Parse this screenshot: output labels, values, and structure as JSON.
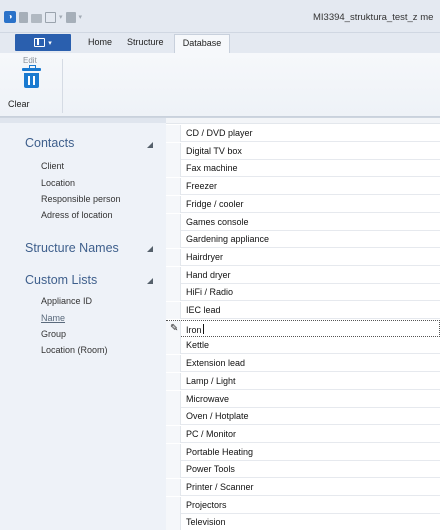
{
  "window": {
    "title": "MI3394_struktura_test_z me"
  },
  "ribbon": {
    "tabs": [
      "Home",
      "Structure",
      "Database"
    ],
    "active_tab": "Database",
    "edit_group_label": "Edit",
    "clear_label": "Clear"
  },
  "sidebar": {
    "contacts": {
      "title": "Contacts",
      "items": [
        "Client",
        "Location",
        "Responsible person",
        "Adress of location"
      ]
    },
    "structure_names": {
      "title": "Structure Names"
    },
    "custom_lists": {
      "title": "Custom Lists",
      "items": [
        "Appliance ID",
        "Name",
        "Group",
        "Location (Room)"
      ],
      "selected": "Name"
    }
  },
  "grid": {
    "rows": [
      "CD / DVD player",
      "Digital TV box",
      "Fax machine",
      "Freezer",
      "Fridge / cooler",
      "Games console",
      "Gardening appliance",
      "Hairdryer",
      "Hand dryer",
      "HiFi / Radio",
      "IEC lead",
      "Iron",
      "Kettle",
      "Extension lead",
      "Lamp / Light",
      "Microwave",
      "Oven / Hotplate",
      "PC / Monitor",
      "Portable Heating",
      "Power Tools",
      "Printer / Scanner",
      "Projectors",
      "Television"
    ],
    "editing_row": "Iron"
  },
  "icons": {
    "edit_indicator": "pencil-icon",
    "clear": "trash-icon",
    "collapse": "collapse-arrow-icon"
  }
}
